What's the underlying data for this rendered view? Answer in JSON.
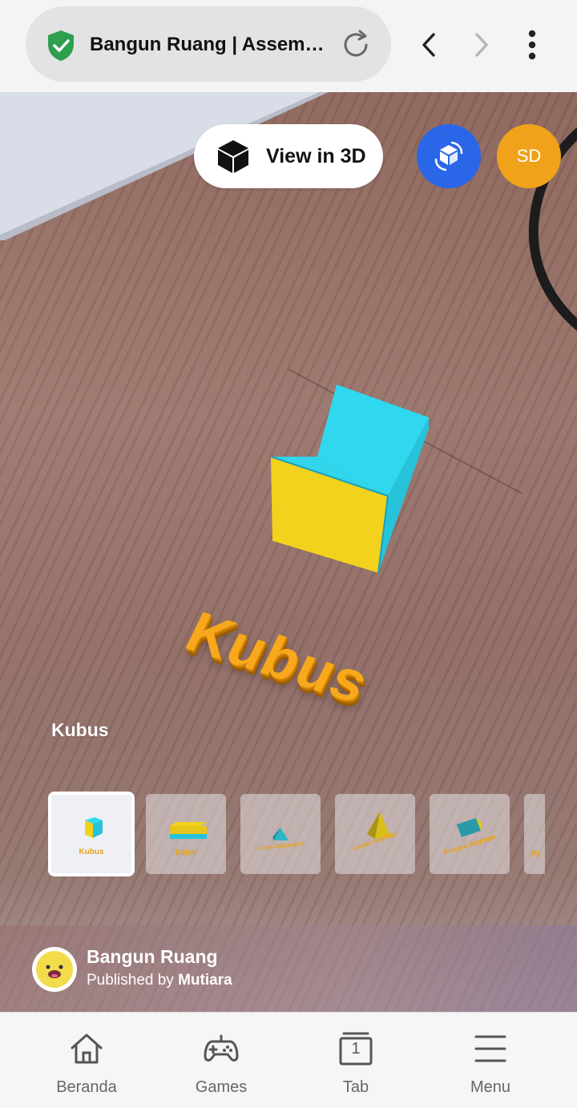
{
  "browser": {
    "page_title": "Bangun Ruang | Assemb…",
    "icons": {
      "secure": "shield-check-icon",
      "reload": "reload-icon",
      "back": "chevron-left-icon",
      "forward": "chevron-right-icon",
      "menu": "more-vertical-icon"
    },
    "colors": {
      "shield": "#2e9e4f",
      "bar": "#f4f4f4",
      "pill": "#e3e3e3"
    }
  },
  "ar": {
    "view3d_label": "View in 3D",
    "rotate_icon": "rotate-cube-icon",
    "user_initials": "SD",
    "scene_object_text": "Kubus",
    "selected_label": "Kubus",
    "colors": {
      "rotate_button": "#2a66e8",
      "user_badge": "#f0a21a",
      "cube_top": "#2fd8ef",
      "cube_front": "#f2d21c",
      "label3d": "#f7a81b"
    }
  },
  "thumbnails": [
    {
      "label": "Kubus",
      "selected": true
    },
    {
      "label": "Balok",
      "selected": false
    },
    {
      "label": "Limas Segiempat",
      "selected": false
    },
    {
      "label": "Limas Segitiga",
      "selected": false
    },
    {
      "label": "Prisma Segitiga",
      "selected": false
    },
    {
      "label": "Pr",
      "selected": false
    }
  ],
  "publisher": {
    "title": "Bangun Ruang",
    "published_by_prefix": "Published by",
    "author": "Mutiara"
  },
  "bottom_nav": [
    {
      "label": "Beranda",
      "icon": "home-icon"
    },
    {
      "label": "Games",
      "icon": "gamepad-icon"
    },
    {
      "label": "Tab",
      "icon": "tab-count-icon",
      "count": "1"
    },
    {
      "label": "Menu",
      "icon": "menu-icon"
    }
  ]
}
